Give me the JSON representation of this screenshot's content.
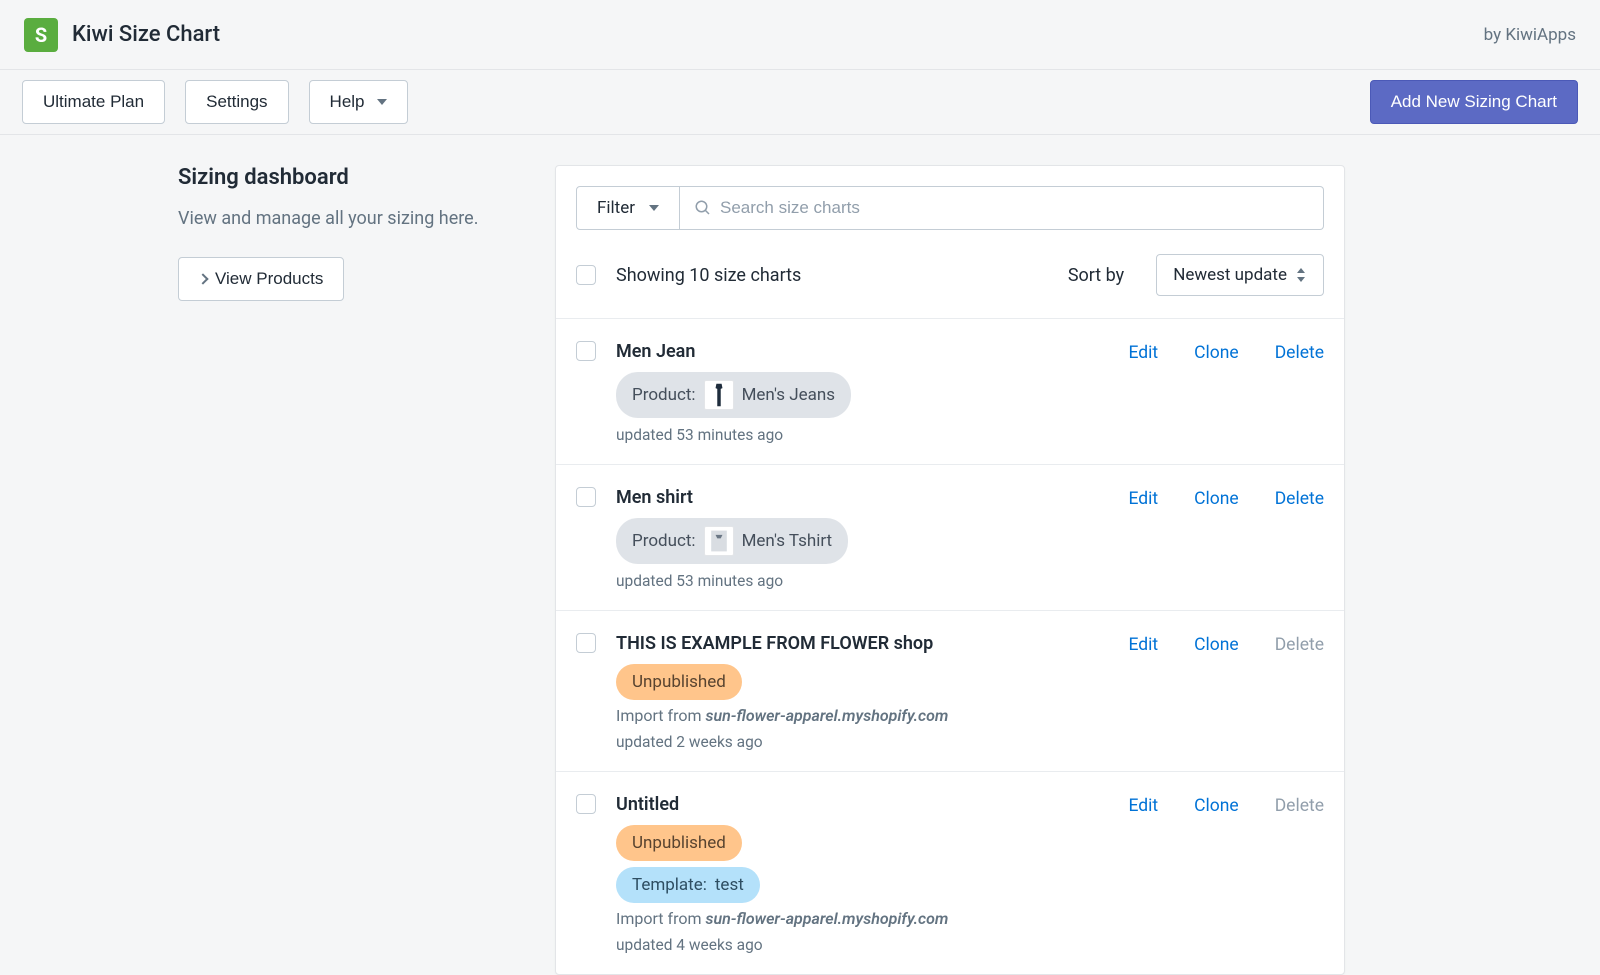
{
  "header": {
    "app_name": "Kiwi Size Chart",
    "by_line": "by KiwiApps"
  },
  "toolbar": {
    "ultimate_plan": "Ultimate Plan",
    "settings": "Settings",
    "help": "Help",
    "add_new": "Add New Sizing Chart"
  },
  "sidebar": {
    "title": "Sizing dashboard",
    "subtitle": "View and manage all your sizing here.",
    "view_products": "View Products"
  },
  "filter": {
    "label": "Filter"
  },
  "search": {
    "placeholder": "Search size charts"
  },
  "list_header": {
    "count_text": "Showing 10 size charts",
    "sort_by": "Sort by",
    "sort_value": "Newest update"
  },
  "actions": {
    "edit": "Edit",
    "clone": "Clone",
    "delete": "Delete"
  },
  "badges": {
    "product_prefix": "Product:",
    "unpublished": "Unpublished",
    "template_prefix": "Template: ",
    "import_prefix": "Import from"
  },
  "rows": [
    {
      "title": "Men Jean",
      "product_name": "Men's Jeans",
      "has_product_badge": true,
      "updated": "updated 53 minutes ago",
      "delete_enabled": true
    },
    {
      "title": "Men shirt",
      "product_name": "Men's Tshirt",
      "has_product_badge": true,
      "updated": "updated 53 minutes ago",
      "delete_enabled": true
    },
    {
      "title": "THIS IS EXAMPLE FROM FLOWER shop",
      "unpublished": true,
      "import_source": "sun-flower-apparel.myshopify.com",
      "updated": "updated 2 weeks ago",
      "delete_enabled": false
    },
    {
      "title": "Untitled",
      "unpublished": true,
      "template": "test",
      "import_source": "sun-flower-apparel.myshopify.com",
      "updated": "updated 4 weeks ago",
      "delete_enabled": false
    }
  ]
}
